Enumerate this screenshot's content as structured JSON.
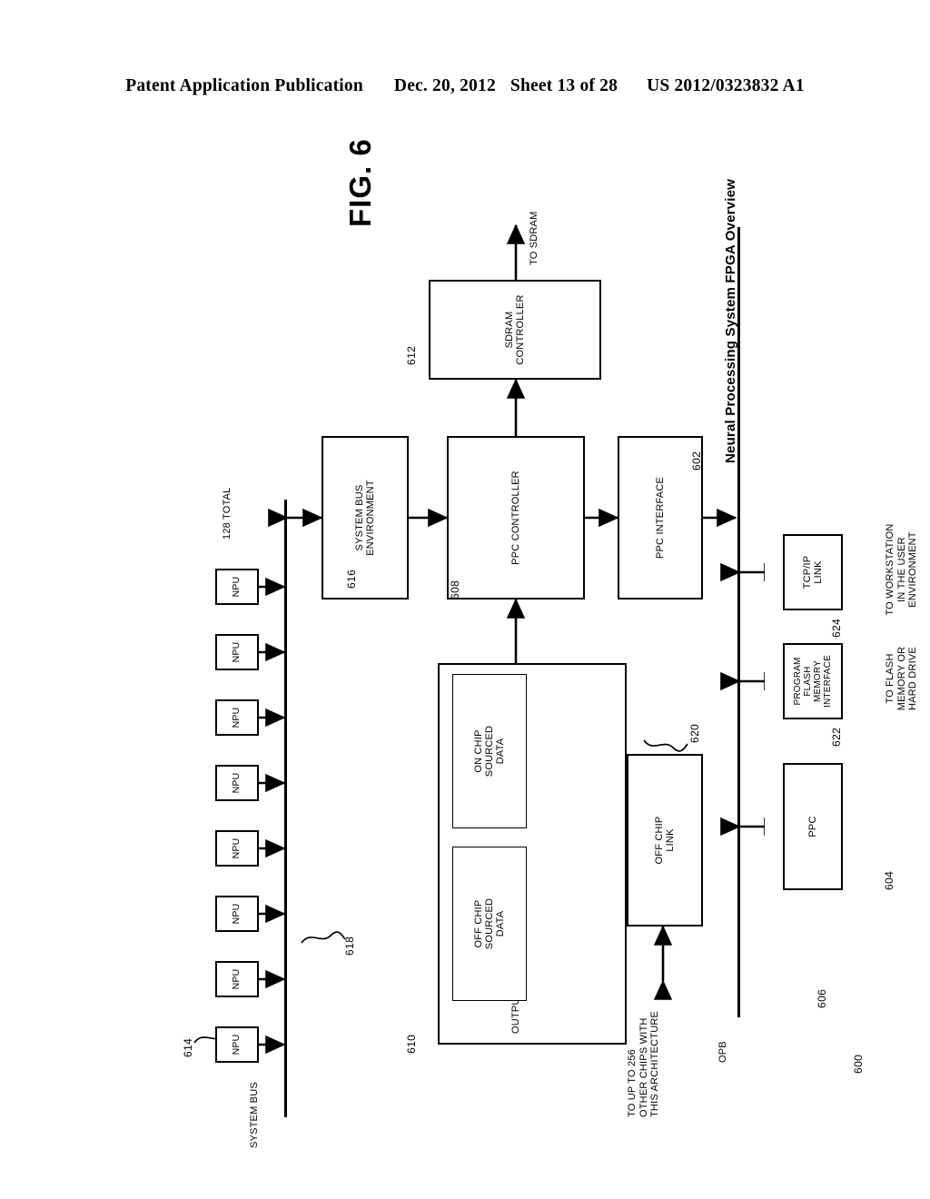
{
  "header": {
    "publication": "Patent Application Publication",
    "date": "Dec. 20, 2012",
    "sheet": "Sheet 13 of 28",
    "patent_number": "US 2012/0323832 A1"
  },
  "figure": {
    "label": "FIG. 6",
    "caption": "Neural Processing System FPGA Overview",
    "overall_ref": "600"
  },
  "buses": {
    "system_bus": {
      "label": "SYSTEM BUS",
      "ref": "618"
    },
    "opb": {
      "label": "OPB",
      "ref": "606"
    }
  },
  "npu": {
    "label": "NPU",
    "ref": "614",
    "count_shown": 8,
    "total_label": "128 TOTAL"
  },
  "blocks": [
    {
      "id": "system_bus_environment",
      "label": "SYSTEM BUS\nENVIRONMENT",
      "ref": "616"
    },
    {
      "id": "ppc_controller",
      "label": "PPC CONTROLLER",
      "ref": "608"
    },
    {
      "id": "sdram_controller",
      "label": "SDRAM CONTROLLER",
      "ref": "612"
    },
    {
      "id": "ppc_interface",
      "label": "PPC INTERFACE",
      "ref": "602"
    },
    {
      "id": "off_chip_link",
      "label": "OFF CHIP\nLINK",
      "ref": "620"
    },
    {
      "id": "ppc",
      "label": "PPC",
      "ref": "604"
    },
    {
      "id": "program_flash_memory_interface",
      "label": "PROGRAM\nFLASH\nMEMORY\nINTERFACE",
      "ref": "622"
    },
    {
      "id": "tcpip_link",
      "label": "TCP/IP\nLINK",
      "ref": "624"
    }
  ],
  "ost": {
    "title": "OUTPUT STORAGE TABLES (OST)",
    "ref": "610",
    "inner": [
      {
        "id": "on_chip_sourced_data",
        "label": "ON CHIP\nSOURCED\nDATA"
      },
      {
        "id": "off_chip_sourced_data",
        "label": "OFF CHIP\nSOURCED\nDATA"
      }
    ]
  },
  "annotations": {
    "to_sdram": "TO SDRAM",
    "to_other_chips": "TO UP TO 256\nOTHER CHIPS WITH\nTHIS ARCHITECTURE",
    "to_flash": "TO FLASH\nMEMORY OR\nHARD DRIVE",
    "to_workstation": "TO WORKSTATION\nIN THE USER\nENVIRONMENT"
  }
}
